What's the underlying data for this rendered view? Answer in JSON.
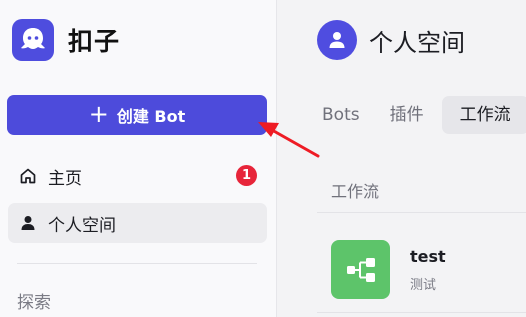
{
  "app": {
    "name": "扣子"
  },
  "sidebar": {
    "create_button": {
      "plus": "+",
      "label": "创建 Bot"
    },
    "nav": [
      {
        "label": "主页",
        "icon": "home-icon",
        "badge": "1"
      },
      {
        "label": "个人空间",
        "icon": "user-icon",
        "active": true
      }
    ],
    "section_label": "探索"
  },
  "main": {
    "space_title": "个人空间",
    "tabs": [
      {
        "label": "Bots"
      },
      {
        "label": "插件"
      },
      {
        "label": "工作流",
        "active": true
      }
    ],
    "list_header": "工作流",
    "items": [
      {
        "title": "test",
        "subtitle": "测试",
        "icon": "workflow-icon"
      }
    ]
  },
  "colors": {
    "brand": "#4d4bdb",
    "badge": "#e7253a",
    "workflow_icon_bg": "#5dc46a",
    "annotation_arrow": "#ee1b24"
  }
}
